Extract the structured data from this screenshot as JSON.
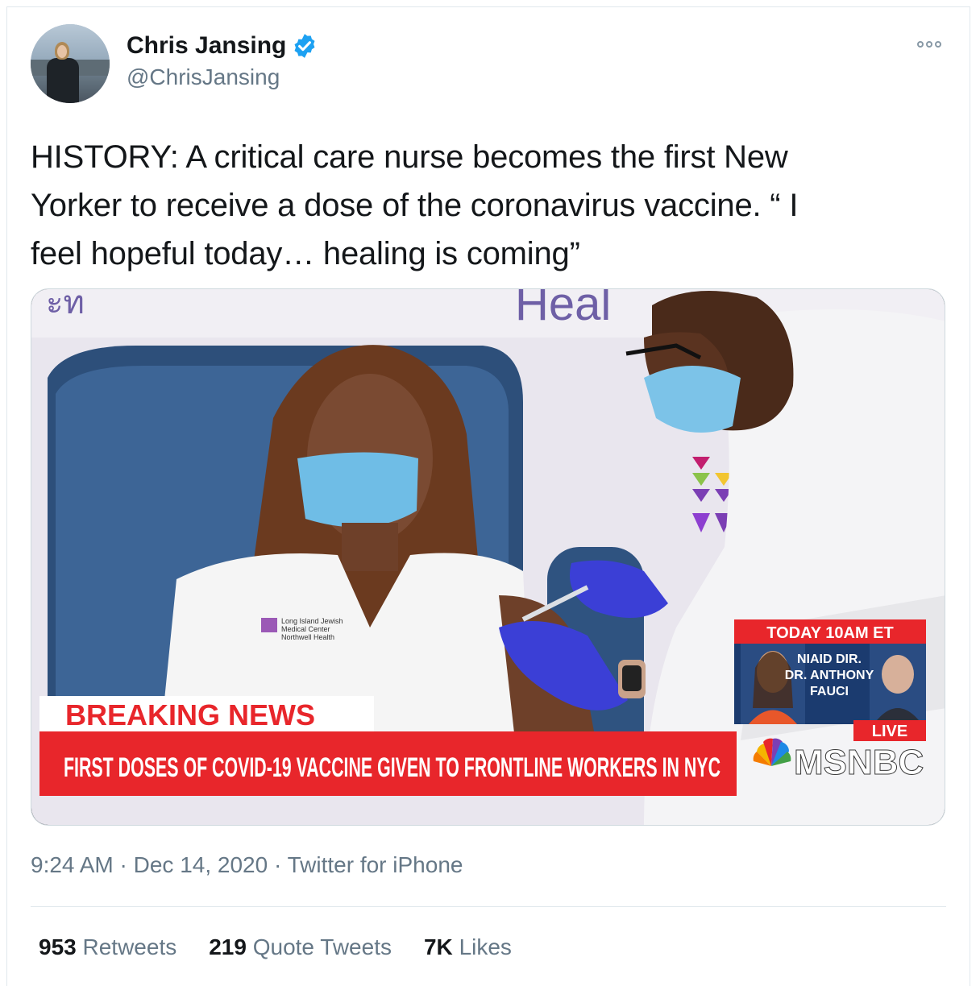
{
  "author": {
    "name": "Chris Jansing",
    "handle": "@ChrisJansing"
  },
  "tweet": {
    "text_line1": "HISTORY:  A critical care nurse becomes the first New",
    "text_line2": "Yorker to receive a dose of the coronavirus vaccine. “ I",
    "text_line3": "feel hopeful today… healing is coming”"
  },
  "media": {
    "backdrop_text": "Heal",
    "chyron_badge": "BREAKING NEWS",
    "chyron_headline": "FIRST DOSES OF COVID-19 VACCINE GIVEN TO FRONTLINE WORKERS IN NYC",
    "promo_header": "TODAY 10AM ET",
    "promo_line1": "NIAID DIR.",
    "promo_line2": "DR. ANTHONY",
    "promo_line3": "FAUCI",
    "live_label": "LIVE",
    "network": "MSNBC",
    "shirt_logo_line1": "Long Island Jewish",
    "shirt_logo_line2": "Medical Center",
    "shirt_logo_line3": "Northwell Health"
  },
  "meta": {
    "time": "9:24 AM",
    "dot1": "·",
    "date": "Dec 14, 2020",
    "dot2": "·",
    "source": "Twitter for iPhone"
  },
  "stats": {
    "retweets_count": "953",
    "retweets_label": "Retweets",
    "quotes_count": "219",
    "quotes_label": "Quote Tweets",
    "likes_count": "7K",
    "likes_label": "Likes"
  },
  "colors": {
    "verified": "#1da1f2",
    "chyron_red": "#e8262b",
    "secondary_text": "#657786"
  }
}
